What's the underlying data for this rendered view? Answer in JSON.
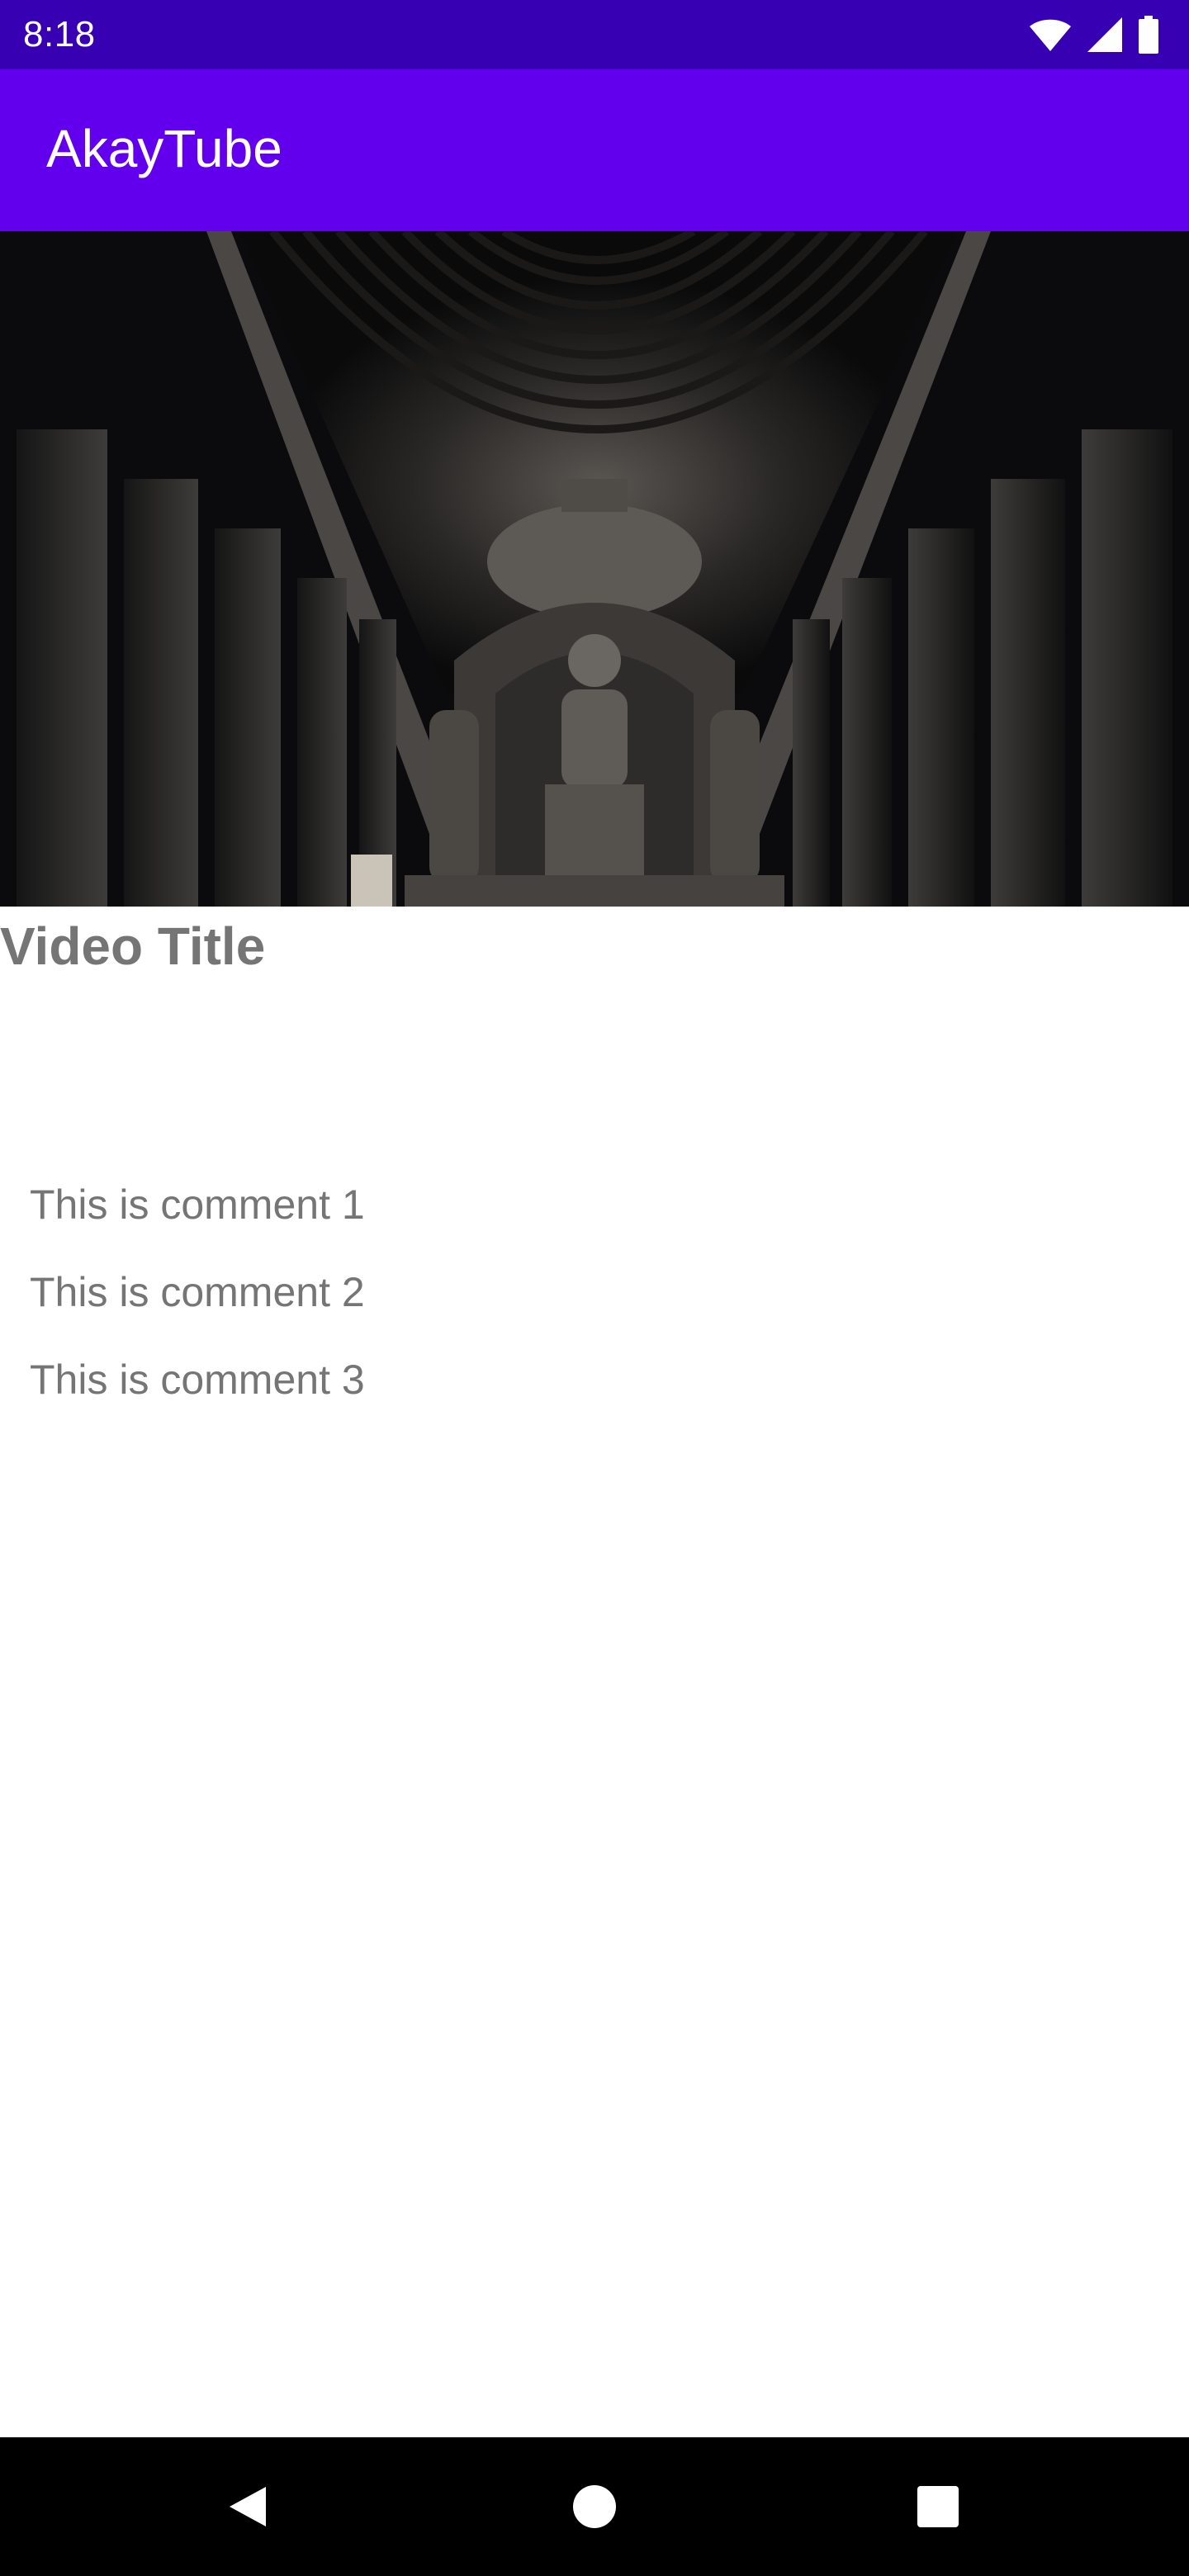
{
  "status_bar": {
    "time": "8:18",
    "icons": [
      "wifi-icon",
      "signal-icon",
      "battery-icon"
    ],
    "background": "#3700b3"
  },
  "app_bar": {
    "title": "AkayTube",
    "background": "#6200ee"
  },
  "video": {
    "thumbnail_icon": "cave-temple-image",
    "title": "Video Title"
  },
  "comments": [
    {
      "text": "This is comment 1"
    },
    {
      "text": "This is comment 2"
    },
    {
      "text": "This is comment 3"
    }
  ],
  "nav_bar": {
    "buttons": [
      "back-icon",
      "home-icon",
      "recents-icon"
    ]
  }
}
